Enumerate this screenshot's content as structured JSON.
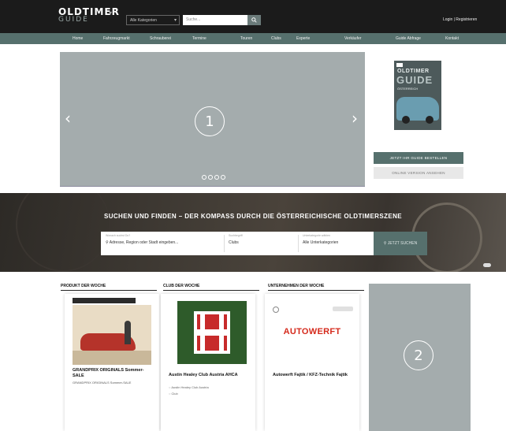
{
  "header": {
    "logo_line1": "OLDTIMER",
    "logo_line2": "GUIDE",
    "category_select": "Alle Kategorien",
    "search_placeholder": "Suche...",
    "login": "Login | Registrieren"
  },
  "nav": {
    "items": [
      "Home",
      "Fahrzeugmarkt",
      "Schrauberei",
      "Termine",
      "Clubs",
      "Experte",
      "Verkäufer",
      "Guide Abfrage",
      "Kontakt",
      "Touren"
    ]
  },
  "hero": {
    "marker": "1",
    "prev_icon": "chevron-left-icon",
    "next_icon": "chevron-right-icon",
    "slide_count": 4
  },
  "sidebar": {
    "magazine_title": "OLDTIMER",
    "magazine_guide": "GUIDE",
    "magazine_sub": "ÖSTERREICH",
    "order_button": "JETZT IHR GUIDE BESTELLEN",
    "archive_button": "ONLINE VERSION ANSEHEN"
  },
  "search_band": {
    "title": "SUCHEN UND FINDEN – DER KOMPASS DURCH DIE ÖSTERREICHISCHE OLDTIMERSZENE",
    "location_label": "Wonach suchst Du?",
    "location_value": "Adresse, Region oder Stadt eingeben...",
    "type_label": "Suchbegriff",
    "type_value": "Clubs",
    "category_label": "Unterkategorie wählen",
    "category_value": "Alle Unterkategorien",
    "search_button": "JETZT SUCHEN"
  },
  "product_of_week": {
    "heading": "PRODUKT DER WOCHE",
    "tag": "",
    "title": "GRANDPRIX ORIGINALS Sommer-SALE",
    "text": "GRANDPRIX ORIGINALS Sommer-SALE"
  },
  "club_of_week": {
    "heading": "CLUB DER WOCHE",
    "title": "Austin Healey Club Austria AHCA",
    "bullets": [
      "Austin Healey Club Austria",
      "Club"
    ]
  },
  "company_of_week": {
    "heading": "UNTERNEHMEN DER WOCHE",
    "logo_text": "AUTOWERFT",
    "logo_sub": "",
    "title": "Autowerft Fajtik / KFZ-Technik Fajtik",
    "bullets": []
  },
  "ad": {
    "marker": "2"
  },
  "colors": {
    "accent": "#56706d",
    "header_bg": "#1b1b1b",
    "placeholder": "#a4acad",
    "brand_red": "#d52a1c"
  }
}
